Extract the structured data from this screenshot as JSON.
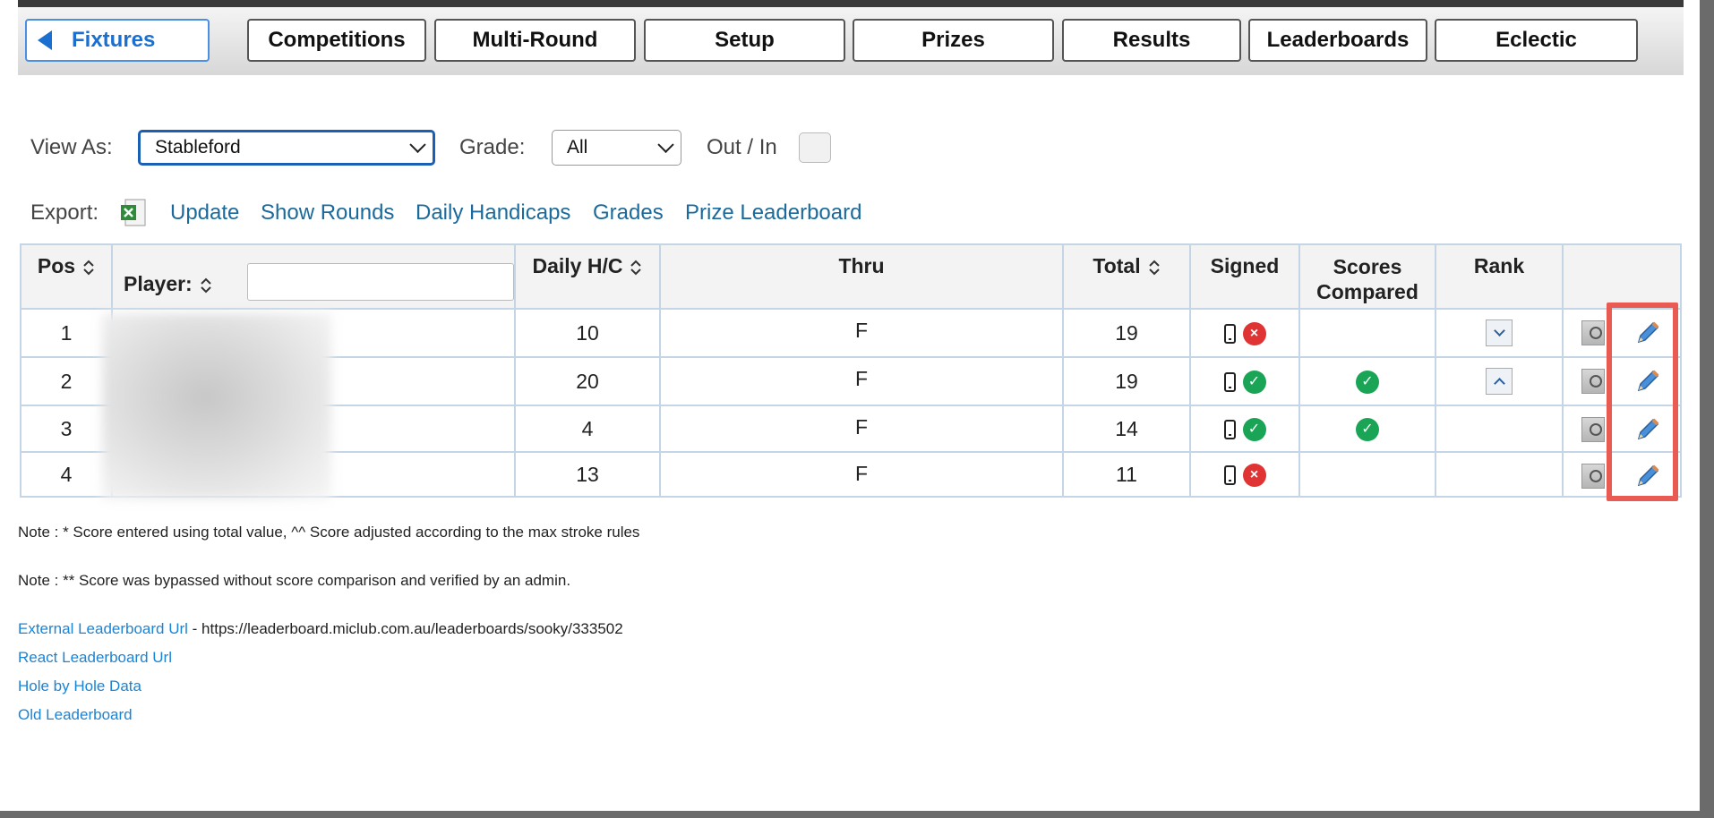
{
  "tabs": [
    {
      "label": "Fixtures",
      "active": true
    },
    {
      "label": "Competitions"
    },
    {
      "label": "Multi-Round"
    },
    {
      "label": "Setup"
    },
    {
      "label": "Prizes"
    },
    {
      "label": "Results"
    },
    {
      "label": "Leaderboards"
    },
    {
      "label": "Eclectic"
    }
  ],
  "filters": {
    "view_as_label": "View As:",
    "view_as_value": "Stableford",
    "grade_label": "Grade:",
    "grade_value": "All",
    "out_in_label": "Out / In"
  },
  "actions": {
    "export_label": "Export:",
    "links": [
      "Update",
      "Show Rounds",
      "Daily Handicaps",
      "Grades",
      "Prize Leaderboard"
    ]
  },
  "table": {
    "headers": {
      "pos": "Pos",
      "player": "Player:",
      "daily_hc": "Daily H/C",
      "thru": "Thru",
      "total": "Total",
      "signed": "Signed",
      "scores_compared": "Scores Compared",
      "rank": "Rank"
    },
    "rows": [
      {
        "pos": "1",
        "daily_hc": "10",
        "thru": "F",
        "total": "19",
        "signed_ok": false,
        "compared": false,
        "rank": "down"
      },
      {
        "pos": "2",
        "daily_hc": "20",
        "thru": "F",
        "total": "19",
        "signed_ok": true,
        "compared": true,
        "rank": "up"
      },
      {
        "pos": "3",
        "daily_hc": "4",
        "thru": "F",
        "total": "14",
        "signed_ok": true,
        "compared": true,
        "rank": ""
      },
      {
        "pos": "4",
        "daily_hc": "13",
        "thru": "F",
        "total": "11",
        "signed_ok": false,
        "compared": false,
        "rank": ""
      }
    ]
  },
  "notes": {
    "note1": "Note : * Score entered using total value, ^^ Score adjusted according to the max stroke rules",
    "note2": "Note : ** Score was bypassed without score comparison and verified by an admin."
  },
  "bottom_links": {
    "external_label": "External Leaderboard Url",
    "external_url_text": " - https://leaderboard.miclub.com.au/leaderboards/sooky/333502",
    "react": "React Leaderboard Url",
    "hole_by_hole": "Hole by Hole Data",
    "old": "Old Leaderboard"
  },
  "colors": {
    "link": "#1a6a9c",
    "bottom_link": "#1a84d6",
    "ok": "#1aa556",
    "bad": "#e03333",
    "highlight": "#e85a52"
  },
  "icons": [
    "back-triangle-icon",
    "excel-icon",
    "sort-icon",
    "phone-icon",
    "check-icon",
    "cross-icon",
    "chevron-down-icon",
    "chevron-up-icon",
    "view-scorecard-icon",
    "pencil-icon"
  ]
}
